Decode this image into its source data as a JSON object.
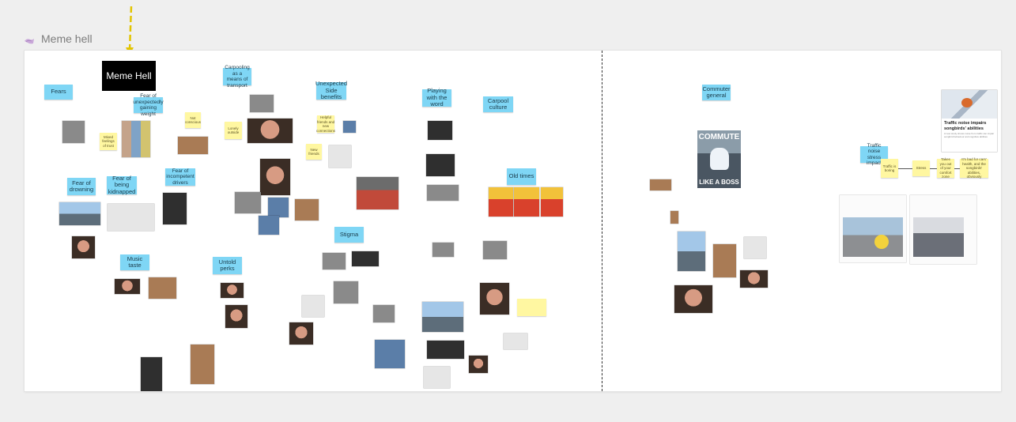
{
  "board": {
    "title": "Meme hell",
    "frame_icon": "frame-icon",
    "pointer": "yellow-dashed-arrow"
  },
  "canvas": {
    "title_card": "Meme Hell",
    "colors": {
      "sticky_blue": "#7fd6f5",
      "sticky_yellow": "#fff7a1",
      "title_card_bg": "#000000",
      "arrow": "#e2c400",
      "background": "#efefef"
    },
    "left_section": {
      "stickies": [
        "Fears",
        "Fear of unexpectedly gaining weight",
        "Carpooling as a means of transport",
        "Unexpected Side benefits",
        "Playing with the word",
        "Carpool culture",
        "Fear of drowning",
        "Fear of being kidnapped",
        "Fear of incompetent drivers",
        "Old times",
        "Stigma",
        "Music taste",
        "Untold perks"
      ],
      "yellow_notes": [
        "Mixed feelings of trust",
        "Not conscious",
        "Lonely outside",
        "Helpful friends and new connections",
        "New friends"
      ]
    },
    "right_section": {
      "stickies": [
        "Commuter general",
        "Traffic noise stress impact"
      ],
      "yellow_notes": [
        "Traffic is boring",
        "Stress",
        "Takes you out of your comfort zone",
        "It's bad for cars' health, and the songbirds' abilities, obviously"
      ],
      "commute_meme": {
        "top_text": "COMMUTE",
        "bottom_text": "LIKE A BOSS"
      },
      "news_card": {
        "headline": "Traffic noise impairs songbirds' abilities",
        "subtext": "A new study shows noise from traffic can impair songbird behaviour and cognitive abilities"
      }
    }
  }
}
